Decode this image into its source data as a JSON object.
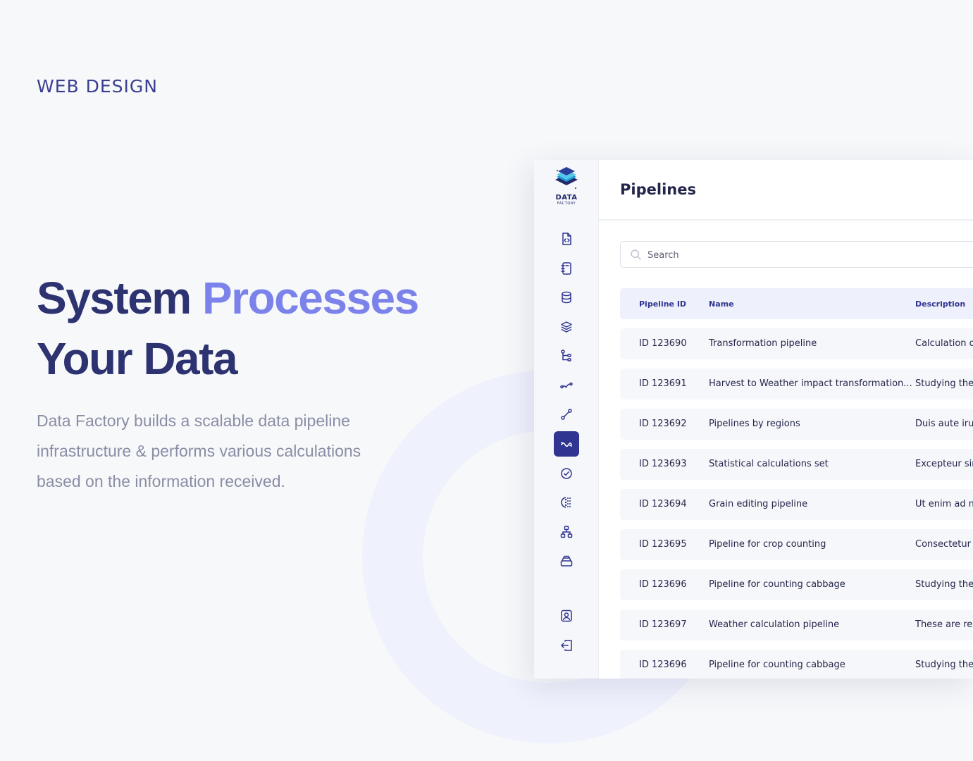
{
  "hero": {
    "kicker": "WEB DESIGN",
    "title_part1": "System ",
    "title_accent": "Processes",
    "title_line2": "Your Data",
    "lead": "Data Factory builds a scalable data pipeline infrastructure & performs various calculations based on the information received."
  },
  "colors": {
    "primary": "#2d3270",
    "accent": "#7b83ea",
    "nav_active": "#2f3590",
    "header_row": "#eef0fb"
  },
  "logo": {
    "word": "DATA",
    "sub": "FACTORY"
  },
  "sidebar": {
    "items": [
      {
        "icon": "file-code-icon"
      },
      {
        "icon": "notebook-icon"
      },
      {
        "icon": "database-icon"
      },
      {
        "icon": "layers-icon"
      },
      {
        "icon": "branch-icon"
      },
      {
        "icon": "trend-wave-icon"
      },
      {
        "icon": "route-icon"
      },
      {
        "icon": "pipelines-icon",
        "active": true
      },
      {
        "icon": "check-circle-icon"
      },
      {
        "icon": "dots-grid-icon"
      },
      {
        "icon": "hierarchy-icon"
      },
      {
        "icon": "tray-icon"
      }
    ],
    "bottom": [
      {
        "icon": "user-profile-icon"
      },
      {
        "icon": "logout-icon"
      }
    ]
  },
  "main": {
    "title": "Pipelines",
    "search_placeholder": "Search",
    "columns": [
      "Pipeline ID",
      "Name",
      "Description"
    ],
    "rows": [
      {
        "id": "ID 123690",
        "name": "Transformation pipeline",
        "desc": "Calculation of t"
      },
      {
        "id": "ID 123691",
        "name": "Harvest to Weather impact transformation...",
        "desc": "Studying the in"
      },
      {
        "id": "ID 123692",
        "name": "Pipelines by regions",
        "desc": "Duis aute irure"
      },
      {
        "id": "ID 123693",
        "name": "Statistical calculations set",
        "desc": "Excepteur sint"
      },
      {
        "id": "ID 123694",
        "name": "Grain editing pipeline",
        "desc": "Ut enim ad min"
      },
      {
        "id": "ID 123695",
        "name": "Pipeline for crop counting",
        "desc": "Consectetur ad"
      },
      {
        "id": "ID 123696",
        "name": "Pipeline for counting cabbage",
        "desc": "Studying the in"
      },
      {
        "id": "ID 123697",
        "name": "Weather calculation pipeline",
        "desc": "These are regi"
      },
      {
        "id": "ID 123696",
        "name": "Pipeline for counting cabbage",
        "desc": "Studying the in"
      }
    ]
  }
}
